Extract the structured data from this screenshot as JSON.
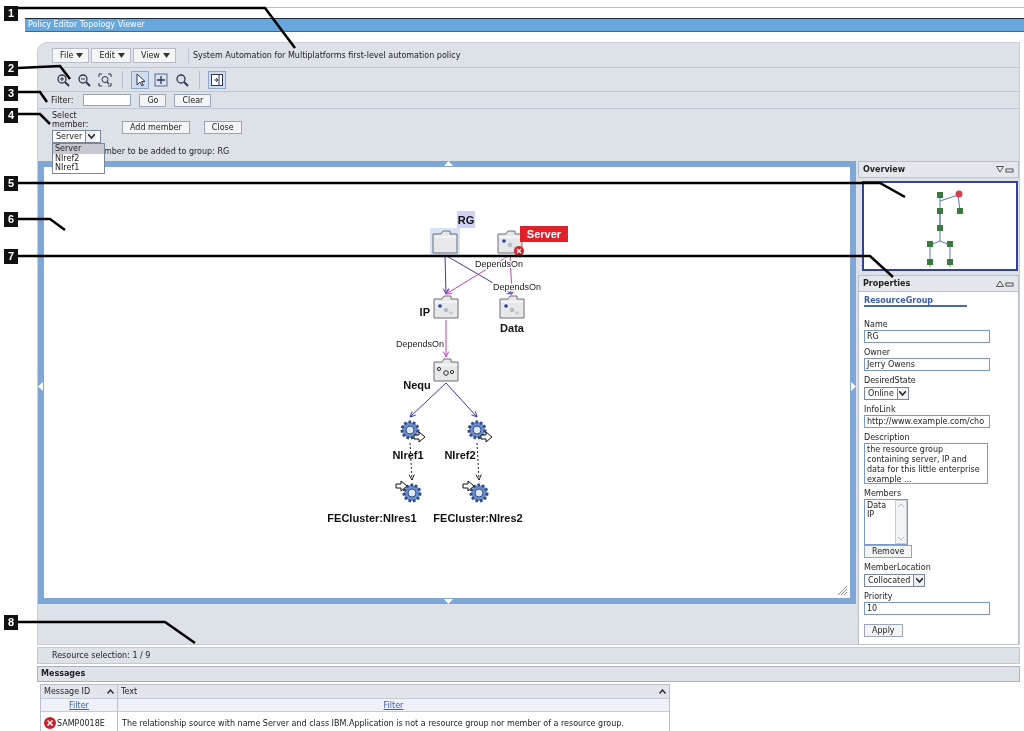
{
  "callouts": [
    "1",
    "2",
    "3",
    "4",
    "5",
    "6",
    "7",
    "8"
  ],
  "window": {
    "title": "Policy Editor Topology Viewer"
  },
  "menus": [
    {
      "label": "File"
    },
    {
      "label": "Edit"
    },
    {
      "label": "View"
    }
  ],
  "policy_title": "System Automation for Multiplatforms first-level automation policy",
  "tool_groups": [
    [
      {
        "kind": "zoom-in",
        "selected": false
      },
      {
        "kind": "zoom-out",
        "selected": false
      },
      {
        "kind": "zoom-fit",
        "selected": false
      }
    ],
    [
      {
        "kind": "pointer",
        "selected": true
      },
      {
        "kind": "pan",
        "selected": false
      },
      {
        "kind": "zoom-tool",
        "selected": false
      }
    ],
    [
      {
        "kind": "panel",
        "selected": true
      }
    ]
  ],
  "filter": {
    "label": "Filter:",
    "buttons": [
      "Go",
      "Clear"
    ]
  },
  "member": {
    "label": "Select member:",
    "value": "Server",
    "expanded": true,
    "options": [
      {
        "label": "Server",
        "selected": true
      },
      {
        "label": "NIref2",
        "selected": false
      },
      {
        "label": "NIref1",
        "selected": false
      }
    ],
    "buttons": [
      "Add member",
      "Close"
    ],
    "hint": "mber to be added to group: RG"
  },
  "graph": {
    "nodes": [
      {
        "label": "RG",
        "kind": "group",
        "selected": true,
        "error": false
      },
      {
        "label": "Server",
        "kind": "application",
        "selected": false,
        "error": true
      },
      {
        "label": "IP",
        "kind": "application",
        "selected": false,
        "error": false
      },
      {
        "label": "Data",
        "kind": "application",
        "selected": false,
        "error": false
      },
      {
        "label": "Nequ",
        "kind": "equivalency",
        "selected": false,
        "error": false
      },
      {
        "label": "NIref1",
        "kind": "reference",
        "selected": false,
        "error": false
      },
      {
        "label": "NIref2",
        "kind": "reference",
        "selected": false,
        "error": false
      },
      {
        "label": "FECluster:NIres1",
        "kind": "referenced",
        "selected": false,
        "error": false
      },
      {
        "label": "FECluster:NIres2",
        "kind": "referenced",
        "selected": false,
        "error": false
      }
    ],
    "edges": [
      {
        "kind": "member"
      },
      {
        "kind": "member"
      },
      {
        "kind": "depends",
        "label": "DependsOn"
      },
      {
        "kind": "depends",
        "label": "DependsOn"
      },
      {
        "kind": "depends",
        "label": "DependsOn"
      },
      {
        "kind": "member"
      },
      {
        "kind": "member"
      },
      {
        "kind": "reference"
      },
      {
        "kind": "reference"
      }
    ]
  },
  "overview": {
    "title": "Overview"
  },
  "properties": {
    "title": "Properties",
    "type_link": "ResourceGroup",
    "fields": [
      {
        "kind": "text",
        "label": "Name",
        "value": "RG"
      },
      {
        "kind": "text",
        "label": "Owner",
        "value": "Jerry Owens"
      },
      {
        "kind": "select",
        "label": "DesiredState",
        "value": "Online"
      },
      {
        "kind": "text",
        "label": "InfoLink",
        "value": "http://www.example.com/cho"
      },
      {
        "kind": "textarea",
        "label": "Description",
        "value": "the resource group containing server, IP and data for this little enterprise example ..."
      },
      {
        "kind": "list",
        "label": "Members",
        "items": [
          "Data",
          "IP"
        ],
        "button": "Remove"
      },
      {
        "kind": "select",
        "label": "MemberLocation",
        "value": "Collocated"
      },
      {
        "kind": "text",
        "label": "Priority",
        "value": "10"
      }
    ],
    "apply": "Apply"
  },
  "status": "Resource selection: 1 / 9",
  "messages": {
    "title": "Messages",
    "columns": [
      {
        "label": "Message ID"
      },
      {
        "label": "Text"
      }
    ],
    "filters": [
      "Filter",
      "Filter"
    ],
    "rows": [
      {
        "error": true,
        "id": "SAMP0018E",
        "text": "The relationship source with name Server and class IBM.Application is not a resource group nor member of a resource group."
      }
    ]
  }
}
